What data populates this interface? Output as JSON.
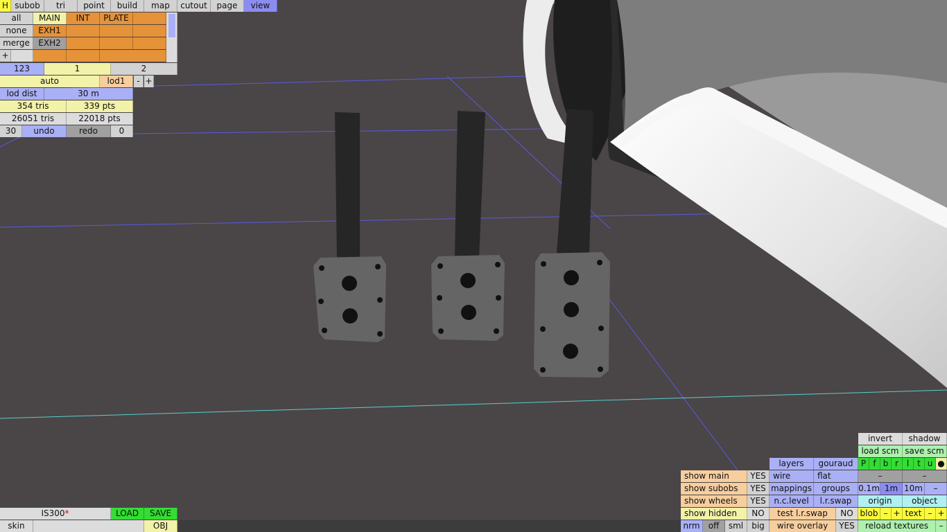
{
  "toolbar": {
    "items": [
      "H",
      "subob",
      "tri",
      "point",
      "build",
      "map",
      "cutout",
      "page",
      "view"
    ],
    "active": "view"
  },
  "layers": {
    "rows": [
      [
        "all",
        "MAIN",
        "INT",
        "PLATE",
        ""
      ],
      [
        "none",
        "EXH1",
        "",
        "",
        ""
      ],
      [
        "merge",
        "EXH2",
        "",
        "",
        ""
      ],
      [
        "+",
        "",
        "",
        "",
        ""
      ]
    ],
    "pages": [
      "123",
      "1",
      "2"
    ]
  },
  "lod": {
    "mode": "auto",
    "name": "lod1",
    "minus": "-",
    "plus": "+",
    "dist_label": "lod dist",
    "dist_value": "30 m"
  },
  "stats": {
    "tris": "354 tris",
    "pts": "339 pts",
    "total_tris": "26051 tris",
    "total_pts": "22018 pts"
  },
  "undo": {
    "count": "30",
    "undo": "undo",
    "redo": "redo",
    "redo_count": "0"
  },
  "file": {
    "name": "IS300",
    "modified_mark": "*",
    "load": "LOAD",
    "save": "SAVE",
    "skin": "skin",
    "skin_value": "",
    "obj": "OBJ"
  },
  "show": [
    {
      "label": "show main",
      "value": "YES"
    },
    {
      "label": "show subobs",
      "value": "YES"
    },
    {
      "label": "show wheels",
      "value": "YES"
    },
    {
      "label": "show hidden",
      "value": "NO"
    }
  ],
  "render": {
    "layers": "layers",
    "gouraud": "gouraud",
    "wire": "wire",
    "flat": "flat",
    "mappings": "mappings",
    "groups": "groups",
    "nc_level": "n.c.level",
    "lr_swap": "l.r.swap",
    "test_lr_swap": "test l.r.swap",
    "test_lr_swap_value": "NO",
    "wire_overlay": "wire overlay",
    "wire_overlay_value": "YES"
  },
  "normals": [
    "nrm",
    "off",
    "sml",
    "big"
  ],
  "right": {
    "invert": "invert",
    "shadow": "shadow",
    "load_scm": "load scm",
    "save_scm": "save scm",
    "flags": [
      "P",
      "f",
      "b",
      "r",
      "l",
      "t",
      "u",
      "●"
    ],
    "dash": "–",
    "scales": [
      "0.1m",
      "1m",
      "10m",
      "–"
    ],
    "origin": "origin",
    "object": "object",
    "blob": "blob",
    "text": "text",
    "minus": "–",
    "plus": "+",
    "reload": "reload textures"
  }
}
